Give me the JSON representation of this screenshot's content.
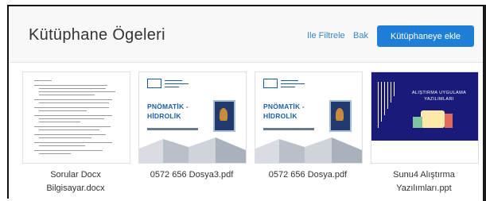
{
  "header": {
    "title": "Kütüphane Ögeleri",
    "filter_link": "Ile Filtrele",
    "view_link": "Bak",
    "add_button": "Kütüphaneye ekle"
  },
  "items": [
    {
      "name_line1": "Sorular Docx",
      "name_line2": "Bilgisayar.docx",
      "type": "docx"
    },
    {
      "name_line1": "0572 656 Dosya3.pdf",
      "name_line2": "",
      "type": "pdf"
    },
    {
      "name_line1": "0572 656 Dosya.pdf",
      "name_line2": "",
      "type": "pdf"
    },
    {
      "name_line1": "Sunu4 Alıştırma",
      "name_line2": "Yazılımları.ppt",
      "type": "ppt"
    }
  ],
  "thumbnails": {
    "pdf_title_line1": "PNÖMATİK -",
    "pdf_title_line2": "HİDROLİK",
    "ppt_title_line1": "ALIŞTIRMA UYGULAMA",
    "ppt_title_line2": "YAZILIMLARI"
  },
  "colors": {
    "accent": "#1f7fd6",
    "link": "#3a86c8",
    "header_bg": "#f8f8f8",
    "ppt_bg": "#1a1a7a"
  }
}
